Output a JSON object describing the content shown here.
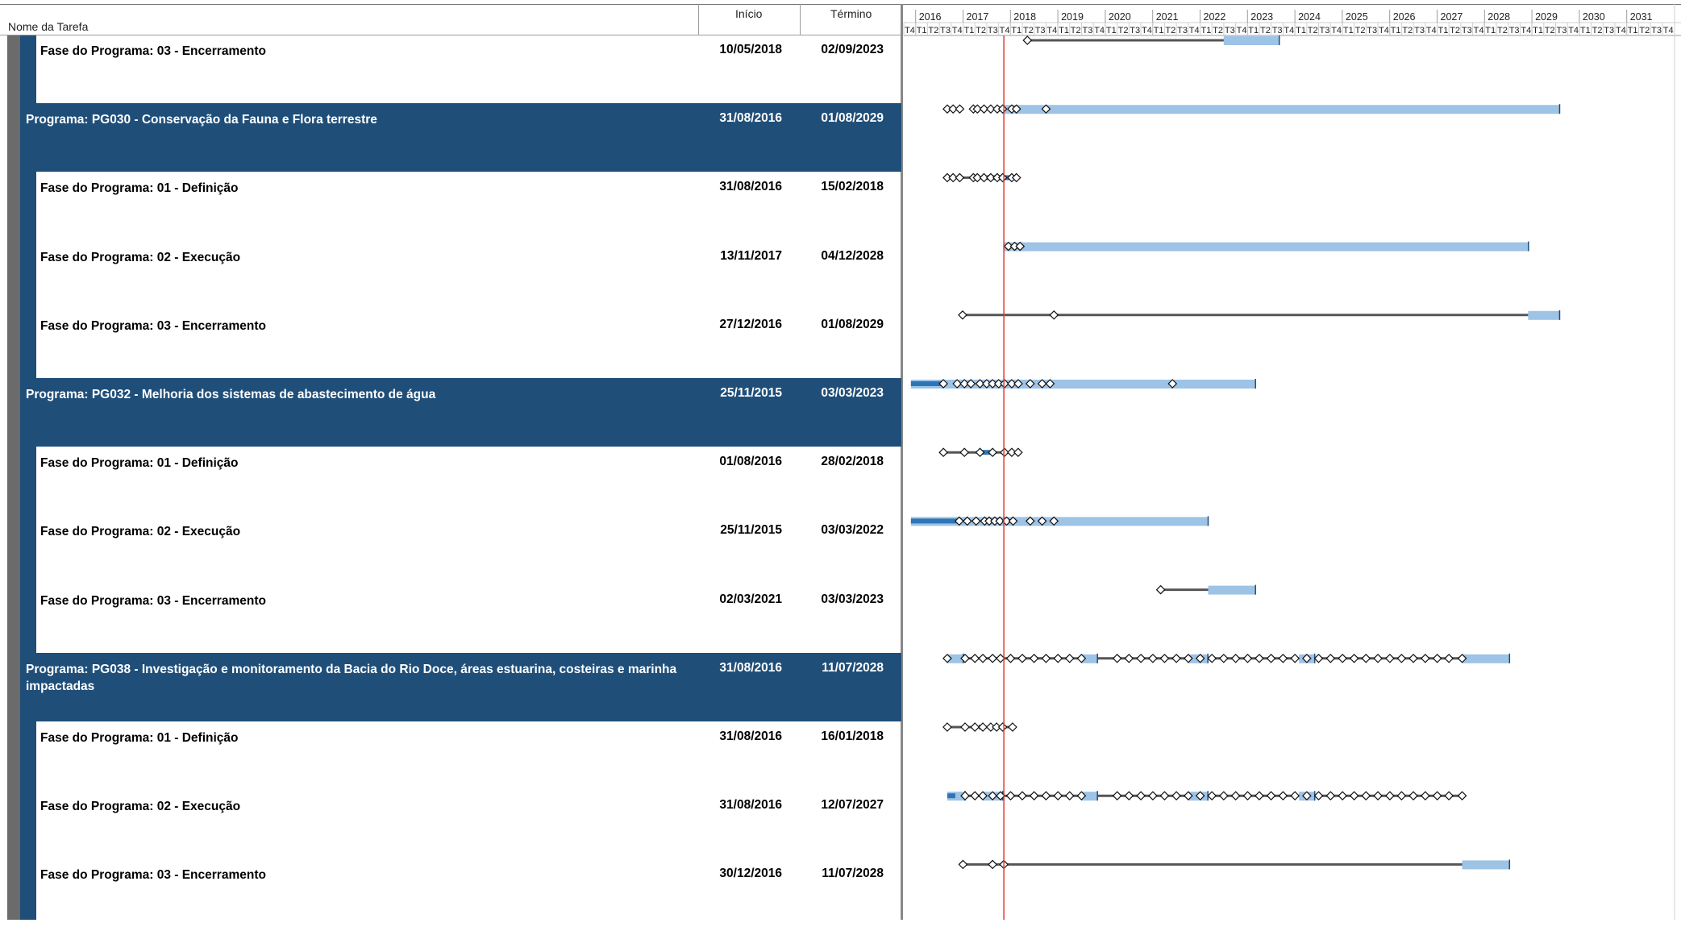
{
  "header": {
    "col_name": "Nome da Tarefa",
    "col_start": "Início",
    "col_end": "Término"
  },
  "timescale": {
    "years": [
      "2016",
      "2017",
      "2018",
      "2019",
      "2020",
      "2021",
      "2022",
      "2023",
      "2024",
      "2025",
      "2026",
      "2027",
      "2028",
      "2029",
      "2030",
      "2031"
    ],
    "quarter_labels": [
      "T4",
      "T1",
      "T2",
      "T3",
      "T4",
      "T1",
      "T2",
      "T3",
      "T4",
      "T1",
      "T2",
      "T3",
      "T4",
      "T1",
      "T2",
      "T3",
      "T4",
      "T1",
      "T2",
      "T3",
      "T4",
      "T1",
      "T2",
      "T3",
      "T4",
      "T1",
      "T2",
      "T3",
      "T4",
      "T1",
      "T2",
      "T3",
      "T4",
      "T1",
      "T2",
      "T3",
      "T4",
      "T1",
      "T2",
      "T3",
      "T4",
      "T1",
      "T2",
      "T3",
      "T4",
      "T1",
      "T2",
      "T3",
      "T4",
      "T1",
      "T2",
      "T3",
      "T4",
      "T1",
      "T2",
      "T3",
      "T4",
      "T1",
      "T2",
      "T3",
      "T4",
      "T1",
      "T2",
      "T3",
      "T4"
    ]
  },
  "colors": {
    "program_row": "#1F4E79",
    "bar_light": "#9DC3E6",
    "bar_dark": "#2E75B6",
    "status_line": "#E03C31",
    "summary_line": "#555555"
  },
  "rows": [
    {
      "type": "phase",
      "name": "Fase do Programa: 03 - Encerramento",
      "start": "10/05/2018",
      "end": "02/09/2023"
    },
    {
      "type": "program",
      "name": "Programa: PG030 - Conservação da Fauna e Flora terrestre",
      "start": "31/08/2016",
      "end": "01/08/2029"
    },
    {
      "type": "phase",
      "name": "Fase do Programa: 01 - Definição",
      "start": "31/08/2016",
      "end": "15/02/2018"
    },
    {
      "type": "phase",
      "name": "Fase do Programa: 02 - Execução",
      "start": "13/11/2017",
      "end": "04/12/2028"
    },
    {
      "type": "phase",
      "name": "Fase do Programa: 03 - Encerramento",
      "start": "27/12/2016",
      "end": "01/08/2029"
    },
    {
      "type": "program",
      "name": "Programa: PG032 - Melhoria dos sistemas de abastecimento de água",
      "start": "25/11/2015",
      "end": "03/03/2023"
    },
    {
      "type": "phase",
      "name": "Fase do Programa: 01 - Definição",
      "start": "01/08/2016",
      "end": "28/02/2018"
    },
    {
      "type": "phase",
      "name": "Fase do Programa: 02 - Execução",
      "start": "25/11/2015",
      "end": "03/03/2022"
    },
    {
      "type": "phase",
      "name": "Fase do Programa: 03 - Encerramento",
      "start": "02/03/2021",
      "end": "03/03/2023"
    },
    {
      "type": "program",
      "name": "Programa: PG038 - Investigação e monitoramento da Bacia do Rio Doce, áreas estuarina, costeiras e marinha impactadas",
      "start": "31/08/2016",
      "end": "11/07/2028"
    },
    {
      "type": "phase",
      "name": "Fase do Programa: 01 - Definição",
      "start": "31/08/2016",
      "end": "16/01/2018"
    },
    {
      "type": "phase",
      "name": "Fase do Programa: 02 - Execução",
      "start": "31/08/2016",
      "end": "12/07/2027"
    },
    {
      "type": "phase",
      "name": "Fase do Programa: 03 - Encerramento",
      "start": "30/12/2016",
      "end": "11/07/2028"
    }
  ],
  "gantt": [
    {
      "line": [
        "2018-05-10",
        "2023-09-02"
      ],
      "bars": [
        [
          "2022-07-01",
          "2023-09-02"
        ]
      ],
      "diamonds": [
        "2018-05-10"
      ]
    },
    {
      "line": [],
      "bars": [
        [
          "2017-11-01",
          "2029-08-01"
        ]
      ],
      "dark": [
        [
          "2017-10-01",
          "2017-11-15"
        ]
      ],
      "diamonds": [
        "2016-08-31",
        "2016-10-15",
        "2016-12-05",
        "2017-03-20",
        "2017-04-20",
        "2017-06-10",
        "2017-08-01",
        "2017-09-20",
        "2017-11-01",
        "2018-01-10",
        "2018-02-15",
        "2018-10-01"
      ]
    },
    {
      "line": [
        "2016-08-31",
        "2018-02-15"
      ],
      "bars": [],
      "dark": [
        [
          "2017-07-01",
          "2018-02-15"
        ]
      ],
      "diamonds": [
        "2016-08-31",
        "2016-10-15",
        "2016-12-05",
        "2017-03-20",
        "2017-04-20",
        "2017-06-10",
        "2017-08-01",
        "2017-09-20",
        "2017-11-01",
        "2018-01-10",
        "2018-02-15"
      ]
    },
    {
      "line": [],
      "bars": [
        [
          "2017-11-13",
          "2028-12-04"
        ]
      ],
      "diamonds": [
        "2017-12-15",
        "2018-02-01",
        "2018-03-15"
      ]
    },
    {
      "line": [
        "2016-12-27",
        "2029-08-01"
      ],
      "bars": [
        [
          "2028-12-01",
          "2029-08-01"
        ]
      ],
      "diamonds": [
        "2016-12-27",
        "2018-12-01"
      ]
    },
    {
      "line": [],
      "bars": [
        [
          "2015-11-25",
          "2023-03-03"
        ]
      ],
      "dark": [
        [
          "2015-11-25",
          "2016-08-01"
        ]
      ],
      "diamonds": [
        "2016-08-01",
        "2016-11-15",
        "2017-01-10",
        "2017-03-01",
        "2017-05-10",
        "2017-07-01",
        "2017-08-15",
        "2017-10-01",
        "2017-11-15",
        "2018-01-10",
        "2018-03-01",
        "2018-06-01",
        "2018-09-01",
        "2018-11-01",
        "2021-06-01"
      ]
    },
    {
      "line": [
        "2016-08-01",
        "2018-02-28"
      ],
      "bars": [],
      "dark": [
        [
          "2017-05-01",
          "2017-08-01"
        ]
      ],
      "diamonds": [
        "2016-08-01",
        "2017-01-10",
        "2017-05-10",
        "2017-08-15",
        "2017-11-15",
        "2018-01-10",
        "2018-02-28"
      ]
    },
    {
      "line": [],
      "bars": [
        [
          "2015-11-25",
          "2022-03-03"
        ]
      ],
      "dark": [
        [
          "2015-11-25",
          "2016-12-01"
        ]
      ],
      "diamonds": [
        "2016-12-01",
        "2017-02-01",
        "2017-04-10",
        "2017-06-15",
        "2017-07-20",
        "2017-09-01",
        "2017-10-10",
        "2017-12-01",
        "2018-01-20",
        "2018-06-01",
        "2018-09-01",
        "2018-12-01"
      ]
    },
    {
      "line": [
        "2021-03-02",
        "2023-03-03"
      ],
      "bars": [
        [
          "2022-03-03",
          "2023-03-03"
        ]
      ],
      "diamonds": [
        "2021-03-02"
      ]
    },
    {
      "line": [
        "2016-08-31",
        "2028-07-11"
      ],
      "bars": [
        [
          "2016-08-31",
          "2017-01-01"
        ],
        [
          "2019-07-01",
          "2019-11-01"
        ],
        [
          "2021-10-01",
          "2022-03-01"
        ],
        [
          "2024-02-01",
          "2024-06-01"
        ],
        [
          "2027-07-12",
          "2028-07-11"
        ]
      ],
      "diamonds": [
        "2016-08-31",
        "2017-01-15",
        "2017-04-01",
        "2017-06-01",
        "2017-08-15",
        "2017-10-15",
        "2018-01-01",
        "2018-04-01",
        "2018-07-01",
        "2018-10-01",
        "2019-01-01",
        "2019-04-01",
        "2019-07-01",
        "2020-04-01",
        "2020-07-01",
        "2020-10-01",
        "2021-01-01",
        "2021-04-01",
        "2021-07-01",
        "2021-10-01",
        "2022-01-01",
        "2022-04-01",
        "2022-07-01",
        "2022-10-01",
        "2023-01-01",
        "2023-04-01",
        "2023-07-01",
        "2023-10-01",
        "2024-01-01",
        "2024-04-01",
        "2024-07-01",
        "2024-10-01",
        "2025-01-01",
        "2025-04-01",
        "2025-07-01",
        "2025-10-01",
        "2026-01-01",
        "2026-04-01",
        "2026-07-01",
        "2026-10-01",
        "2027-01-01",
        "2027-04-01",
        "2027-07-12"
      ]
    },
    {
      "line": [
        "2016-08-31",
        "2018-01-16"
      ],
      "bars": [],
      "dark": [
        [
          "2017-05-01",
          "2017-06-15"
        ]
      ],
      "diamonds": [
        "2016-08-31",
        "2017-01-15",
        "2017-04-01",
        "2017-06-01",
        "2017-08-01",
        "2017-09-15",
        "2017-11-01",
        "2018-01-16"
      ]
    },
    {
      "line": [
        "2016-08-31",
        "2027-07-12"
      ],
      "bars": [
        [
          "2016-08-31",
          "2017-01-15"
        ],
        [
          "2017-06-01",
          "2017-11-01"
        ],
        [
          "2019-07-01",
          "2019-11-01"
        ],
        [
          "2021-10-01",
          "2022-03-01"
        ],
        [
          "2024-02-01",
          "2024-06-01"
        ]
      ],
      "dark": [
        [
          "2016-08-31",
          "2016-11-01"
        ]
      ],
      "diamonds": [
        "2017-01-15",
        "2017-04-01",
        "2017-06-01",
        "2017-08-15",
        "2017-10-15",
        "2018-01-01",
        "2018-04-01",
        "2018-07-01",
        "2018-10-01",
        "2019-01-01",
        "2019-04-01",
        "2019-07-01",
        "2020-04-01",
        "2020-07-01",
        "2020-10-01",
        "2021-01-01",
        "2021-04-01",
        "2021-07-01",
        "2021-10-01",
        "2022-01-01",
        "2022-04-01",
        "2022-07-01",
        "2022-10-01",
        "2023-01-01",
        "2023-04-01",
        "2023-07-01",
        "2023-10-01",
        "2024-01-01",
        "2024-04-01",
        "2024-07-01",
        "2024-10-01",
        "2025-01-01",
        "2025-04-01",
        "2025-07-01",
        "2025-10-01",
        "2026-01-01",
        "2026-04-01",
        "2026-07-01",
        "2026-10-01",
        "2027-01-01",
        "2027-04-01",
        "2027-07-12"
      ]
    },
    {
      "line": [
        "2016-12-30",
        "2028-07-11"
      ],
      "bars": [
        [
          "2027-07-12",
          "2028-07-11"
        ]
      ],
      "diamonds": [
        "2016-12-30",
        "2017-08-15",
        "2017-11-10"
      ]
    }
  ],
  "status_date": "2017-11-10"
}
